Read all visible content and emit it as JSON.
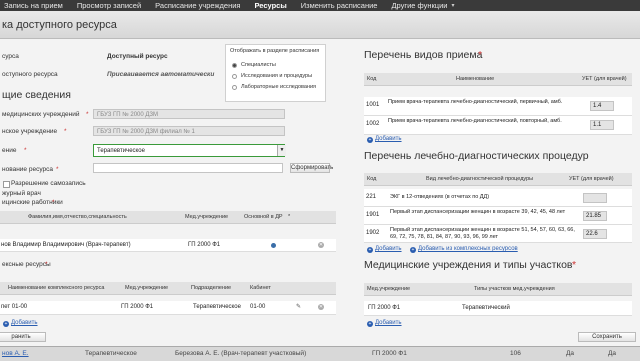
{
  "topnav": {
    "items": [
      {
        "label": "Запись на прием",
        "active": false
      },
      {
        "label": "Просмотр записей",
        "active": false
      },
      {
        "label": "Расписание учреждения",
        "active": false
      },
      {
        "label": "Ресурсы",
        "active": true
      },
      {
        "label": "Изменить расписание",
        "active": false
      },
      {
        "label": "Другие функции",
        "active": false
      }
    ]
  },
  "dialog": {
    "title": "ка доступного ресурса",
    "resource_label": "сурса",
    "resource_value": "Доступный ресурс",
    "code_label": "оступного ресурса",
    "code_value": "Присваивается автоматически",
    "general_heading": "щие сведения",
    "inst_label": "медицинских учреждений",
    "inst_value": "ГБУЗ ГП № 2000 ДЗМ",
    "branch_label": "нское учреждение",
    "branch_value": "ГБУЗ ГП № 2000 ДЗМ филиал № 1",
    "dept_label": "ение",
    "dept_value": "Терапевтическое",
    "resname_label": "нование ресурса",
    "form_button": "Сформировать",
    "checkbox_label_1": "Разрешение самозапись",
    "checkbox_label_2": "журный врач",
    "workers_label": "ицинские работники",
    "workers_cols": [
      "Фамилия,имя,отчество,специальность",
      "Мед.учреждение",
      "Основной в ДР"
    ],
    "workers_rows": [
      {
        "name": "нов Владимир Владимирович (Врач-терапевт)",
        "inst": "ГП 2000 Ф1"
      }
    ],
    "complex_label": "ексные ресурсы",
    "complex_cols": [
      "Наименование комплексного ресурса",
      "Мед.учреждение",
      "Подразделение",
      "Кабинет"
    ],
    "complex_rows": [
      {
        "name": "пет 01-00",
        "inst": "ГП 2000 Ф1",
        "dept": "Терапевтическое",
        "room": "01-00"
      }
    ],
    "add_link": "Добавить",
    "save_left": "ранить",
    "save_right": "Сохранить"
  },
  "display_group": {
    "heading": "Отображать в разделе расписания",
    "options": [
      {
        "label": "Специалисты",
        "checked": true
      },
      {
        "label": "Исследования и процедуры",
        "checked": false
      },
      {
        "label": "Лабораторные исследования",
        "checked": false
      }
    ]
  },
  "visit_types": {
    "heading": "Перечень видов приема",
    "cols": [
      "Код",
      "Наименование",
      "УЕТ (для врачей)"
    ],
    "rows": [
      {
        "code": "1001",
        "name": "Прием врача-терапевта лечебно-диагностический, первичный, амб.",
        "uet": "1.4"
      },
      {
        "code": "1002",
        "name": "Прием врача-терапевта лечебно-диагностический, повторный, амб.",
        "uet": "1.1"
      }
    ],
    "add_link": "Добавить"
  },
  "procedures": {
    "heading": "Перечень лечебно-диагностических процедур",
    "cols": [
      "Код",
      "Вид лечебно-диагностической процедуры",
      "УЕТ (для врачей)"
    ],
    "rows": [
      {
        "code": "221",
        "name": "ЭКГ в 12-отведениях (в отчетах по ДД)",
        "uet": ""
      },
      {
        "code": "1901",
        "name": "Первый этап диспансеризации женщин в возрасте 39, 42, 45, 48 лет",
        "uet": "21.85"
      },
      {
        "code": "1902",
        "name": "Первый этап диспансеризации женщин в возрасте 51, 54, 57, 60, 63, 66, 69, 72, 75, 78, 81, 84, 87, 90, 93, 96, 99 лет",
        "uet": "22.6"
      }
    ],
    "add_link": "Добавить",
    "add_complex_link": "Добавить из комплексных ресурсов"
  },
  "institutions": {
    "heading": "Медицинские учреждения и типы участков",
    "cols": [
      "Мед.учреждение",
      "Типы участков мед.учреждения"
    ],
    "rows": [
      {
        "inst": "ГП 2000 Ф1",
        "type": "Терапевтический"
      }
    ],
    "add_link": "Добавить"
  },
  "statusbar": {
    "cells": [
      "нов А. Е.",
      "Терапевтическое",
      "Березова А. Е. (Врач-терапевт участковый)",
      "ГП 2000 Ф1",
      "106",
      "Да",
      "Да"
    ]
  }
}
